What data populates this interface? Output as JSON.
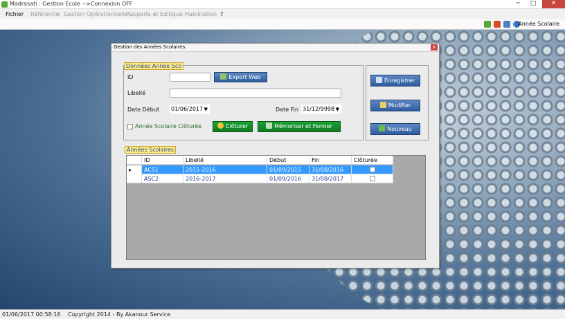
{
  "window": {
    "title": "Madrasati : Gestion Ecole -->Connexion OFF",
    "controls": {
      "minimize": "─",
      "maximize": "□",
      "close": "✕"
    }
  },
  "menu": [
    "Fichier",
    "Référentiel",
    "Gestion Opérationnelle",
    "Rapports et Editique",
    "Habilitation",
    "?"
  ],
  "toolbar": {
    "icons": [
      "plug-connect-icon",
      "plug-disconnect-icon",
      "home-icon",
      "help-icon"
    ],
    "current_module": "Année Scolaire"
  },
  "dialog": {
    "title": "Gestion des Années Scolaires",
    "close": "x",
    "form": {
      "legend": "Données Année Sco",
      "id_label": "ID",
      "id_value": "",
      "export_label": "Export Web",
      "libelle_label": "Libellé",
      "libelle_value": "",
      "date_debut_label": "Date Début",
      "date_debut_value": "01/06/2017",
      "date_fin_label": "Date Fin",
      "date_fin_value": "31/12/9998",
      "cloturee_label": "Année Scolaire Clôturée",
      "cloturer_label": "Clôturer",
      "memoriser_label": "Mémoriser et Fermer"
    },
    "actions": {
      "enregistrer": "Enregistrer",
      "modifier": "Modifier",
      "nouveau": "Nouveau"
    },
    "list": {
      "legend": "Années Scolaires",
      "columns": [
        "ID",
        "Libellé",
        "Début",
        "Fin",
        "Clôturée"
      ],
      "rows": [
        {
          "id": "ACS1",
          "libelle": "2015-2016",
          "debut": "01/09/2015",
          "fin": "31/08/2016",
          "cloturee": false
        },
        {
          "id": "ASC2",
          "libelle": "2016-2017",
          "debut": "01/09/2016",
          "fin": "31/08/2017",
          "cloturee": false
        }
      ]
    }
  },
  "status": {
    "datetime": "01/06/2017 00:58:16",
    "copyright": "Copyright 2014 - By Akanour Service"
  },
  "colors": {
    "accent_blue": "#2f5d9e",
    "accent_green": "#0e7a22",
    "selection": "#3399ff",
    "legend_bg": "#ffe98a"
  }
}
